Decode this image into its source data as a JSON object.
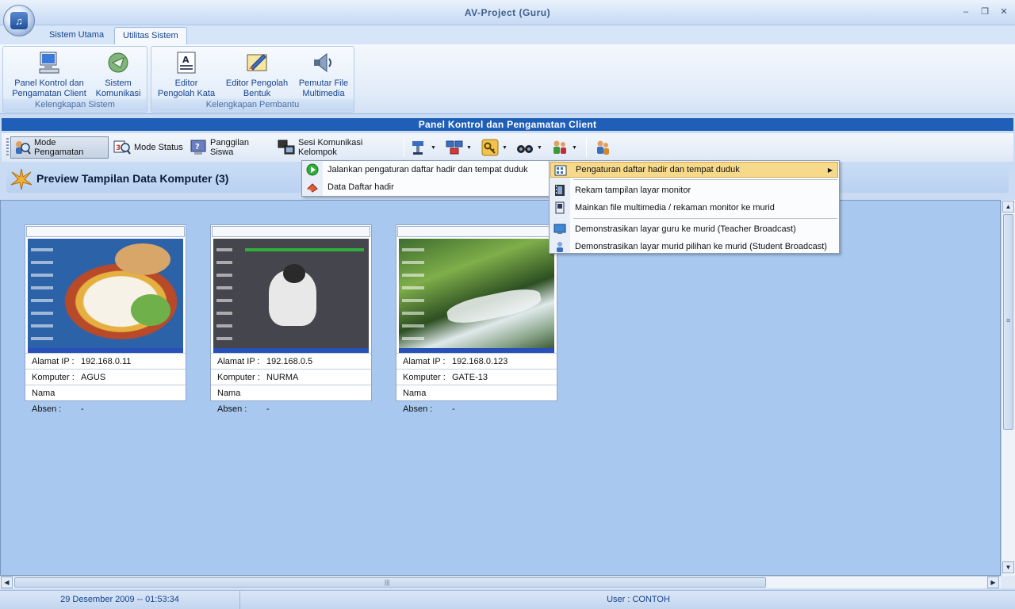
{
  "window": {
    "title": "AV-Project (Guru)",
    "minimize": "–",
    "restore": "❐",
    "close": "✕"
  },
  "ribbon_tabs": [
    {
      "label": "Sistem Utama"
    },
    {
      "label": "Utilitas Sistem"
    }
  ],
  "ribbon_groups": [
    {
      "label": "Kelengkapan Sistem",
      "buttons": [
        {
          "label1": "Panel Kontrol dan",
          "label2": "Pengamatan Client"
        },
        {
          "label1": "Sistem",
          "label2": "Komunikasi"
        }
      ]
    },
    {
      "label": "Kelengkapan Pembantu",
      "buttons": [
        {
          "label1": "Editor",
          "label2": "Pengolah Kata"
        },
        {
          "label1": "Editor Pengolah",
          "label2": "Bentuk"
        },
        {
          "label1": "Pemutar File",
          "label2": "Multimedia"
        }
      ]
    }
  ],
  "panel": {
    "title": "Panel Kontrol dan Pengamatan Client"
  },
  "toolbar": {
    "mode_pengamatan": "Mode Pengamatan",
    "mode_status": "Mode Status",
    "panggilan_siswa": "Panggilan Siswa",
    "sesi_komunikasi": "Sesi Komunikasi Kelompok",
    "dropdown_arrow": "▼"
  },
  "preview": {
    "title": "Preview Tampilan Data Komputer (3)"
  },
  "labels": {
    "ip": "Alamat IP :",
    "komputer": "Komputer :",
    "nama_absen": "Nama Absen :"
  },
  "computers": [
    {
      "ip": "192.168.0.11",
      "komputer": "AGUS",
      "nama_absen": "-"
    },
    {
      "ip": "192.168.0.5",
      "komputer": "NURMA",
      "nama_absen": "-"
    },
    {
      "ip": "192.168.0.123",
      "komputer": "GATE-13",
      "nama_absen": "-"
    }
  ],
  "menu_left": [
    {
      "label": "Jalankan pengaturan daftar hadir dan tempat duduk",
      "icon": "play-green-icon"
    },
    {
      "label": "Data Daftar hadir",
      "icon": "eraser-icon"
    }
  ],
  "menu_right": [
    {
      "label": "Pengaturan daftar hadir dan tempat duduk",
      "icon": "grid-seat-icon",
      "submenu_arrow": "▶"
    },
    {
      "label": "Rekam tampilan layar monitor",
      "icon": "film-icon"
    },
    {
      "label": "Mainkan file multimedia / rekaman monitor ke murid",
      "icon": "media-icon"
    },
    {
      "label": "Demonstrasikan layar guru ke murid (Teacher Broadcast)",
      "icon": "monitor-icon"
    },
    {
      "label": "Demonstrasikan layar murid pilihan ke murid (Student Broadcast)",
      "icon": "student-icon"
    }
  ],
  "scroll": {
    "up": "▲",
    "down": "▼",
    "left": "◀",
    "right": "▶",
    "grip_v": "≡",
    "grip_h": "|||"
  },
  "status": {
    "datetime": "29 Desember 2009 -- 01:53:34",
    "user": "User : CONTOH"
  },
  "colors": {
    "accent": "#1f5fb8",
    "content_bg": "#a8c8ef",
    "highlight": "#f6d98a"
  }
}
